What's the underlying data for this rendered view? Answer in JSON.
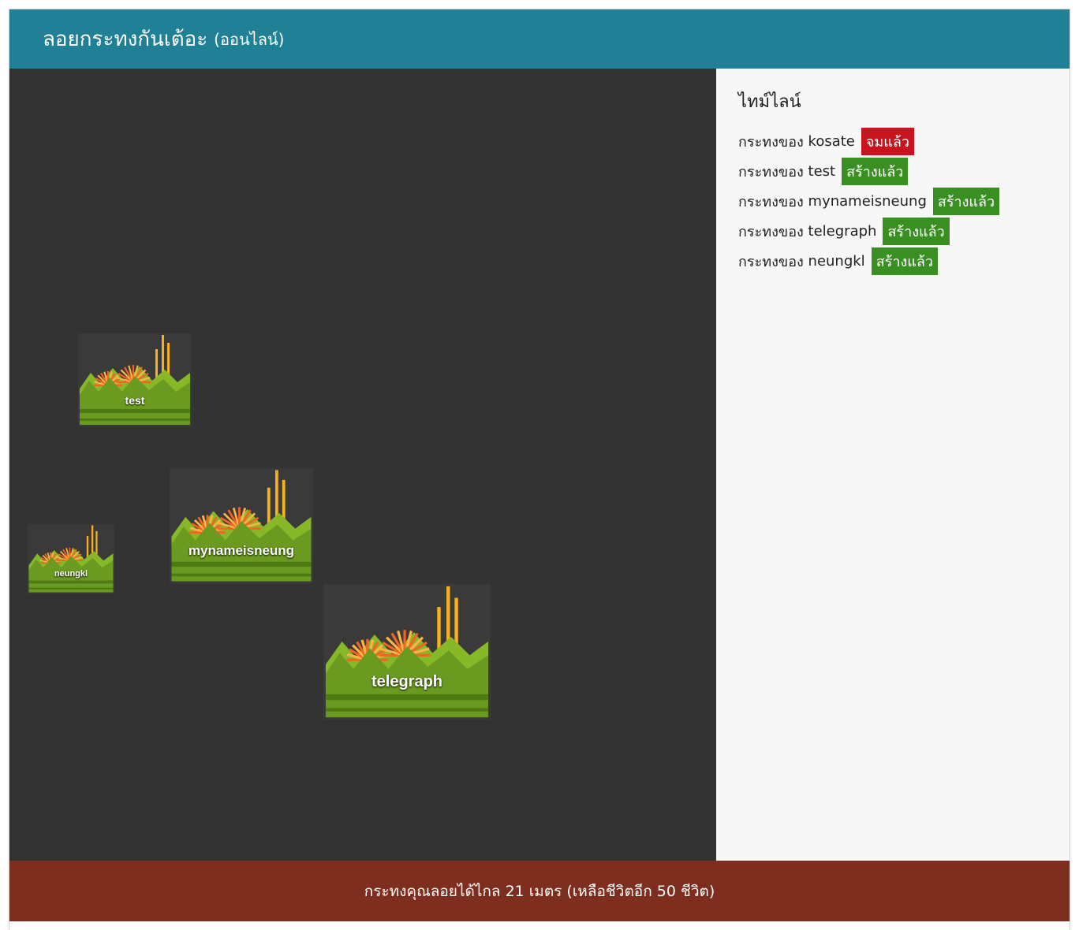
{
  "header": {
    "title": "ลอยกระทงกันเต้อะ",
    "subtitle": "(ออนไลน์)"
  },
  "timeline": {
    "title": "ไทม์ไลน์",
    "items": [
      {
        "prefix": "กระทงของ",
        "user": "kosate",
        "status": "จมแล้ว",
        "status_color": "#c8141e"
      },
      {
        "prefix": "กระทงของ",
        "user": "test",
        "status": "สร้างแล้ว",
        "status_color": "#3a8f22"
      },
      {
        "prefix": "กระทงของ",
        "user": "mynameisneung",
        "status": "สร้างแล้ว",
        "status_color": "#3a8f22"
      },
      {
        "prefix": "กระทงของ",
        "user": "telegraph",
        "status": "สร้างแล้ว",
        "status_color": "#3a8f22"
      },
      {
        "prefix": "กระทงของ",
        "user": "neungkl",
        "status": "สร้างแล้ว",
        "status_color": "#3a8f22"
      }
    ]
  },
  "krathongs": [
    {
      "name": "test"
    },
    {
      "name": "mynameisneung"
    },
    {
      "name": "neungkl"
    },
    {
      "name": "telegraph"
    }
  ],
  "footer": {
    "text": "กระทงคุณลอยได้ไกล 21 เมตร (เหลือชีวิตอีก 50 ชีวิต)"
  },
  "colors": {
    "header_bg": "#1f8096",
    "game_bg": "#333333",
    "footer_bg": "#7d2e1e",
    "leaf_green": "#6a9a1f",
    "flower_orange": "#f26522",
    "candle_yellow": "#f5b120"
  }
}
